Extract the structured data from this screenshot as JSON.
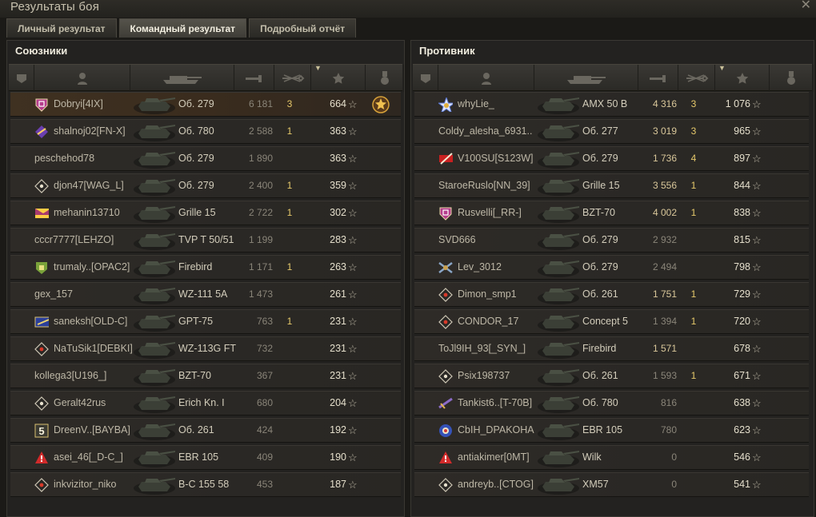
{
  "window": {
    "title": "Результаты боя",
    "close": "✕"
  },
  "tabs": [
    "Личный результат",
    "Командный результат",
    "Подробный отчёт"
  ],
  "active_tab": 1,
  "left": {
    "title": "Союзники",
    "rows": [
      {
        "player": "Dobryi[4IX]",
        "tank": "Об. 279",
        "damage": "6 181",
        "kills": "3",
        "xp": "664",
        "self": true,
        "medal": true,
        "badge": "shield",
        "dmg_hi": false
      },
      {
        "player": "shalnoj02[FN-X]",
        "tank": "Об. 780",
        "damage": "2 588",
        "kills": "1",
        "xp": "363",
        "badge": "purple"
      },
      {
        "player": "peschehod78",
        "tank": "Об. 279",
        "damage": "1 890",
        "kills": "",
        "xp": "363",
        "badge": ""
      },
      {
        "player": "djon47[WAG_L]",
        "tank": "Об. 279",
        "damage": "2 400",
        "kills": "1",
        "xp": "359",
        "badge": "diamond"
      },
      {
        "player": "mehanin13710",
        "tank": "Grille 15",
        "damage": "2 722",
        "kills": "1",
        "xp": "302",
        "badge": "legion"
      },
      {
        "player": "cccr7777[LEHZO]",
        "tank": "TVP T 50/51",
        "damage": "1 199",
        "kills": "",
        "xp": "283",
        "badge": ""
      },
      {
        "player": "trumaly..[OPAC2]",
        "tank": "Firebird",
        "damage": "1 171",
        "kills": "1",
        "xp": "263",
        "badge": "green"
      },
      {
        "player": "gex_157",
        "tank": "WZ-111 5A",
        "damage": "1 473",
        "kills": "",
        "xp": "261",
        "badge": ""
      },
      {
        "player": "saneksh[OLD-C]",
        "tank": "GPT-75",
        "damage": "763",
        "kills": "1",
        "xp": "231",
        "badge": "blue"
      },
      {
        "player": "NaTuSik1[DEBKI]",
        "tank": "WZ-113G FT",
        "damage": "732",
        "kills": "",
        "xp": "231",
        "badge": "diamond-red"
      },
      {
        "player": "kollega3[U196_]",
        "tank": "BZT-70",
        "damage": "367",
        "kills": "",
        "xp": "231",
        "badge": ""
      },
      {
        "player": "Geralt42rus",
        "tank": "Erich Kn. I",
        "damage": "680",
        "kills": "",
        "xp": "204",
        "badge": "diamond"
      },
      {
        "player": "DreenV..[BAYBA]",
        "tank": "Об. 261",
        "damage": "424",
        "kills": "",
        "xp": "192",
        "badge": "five",
        "badge_text": "5"
      },
      {
        "player": "asei_46[_D-C_]",
        "tank": "EBR 105",
        "damage": "409",
        "kills": "",
        "xp": "190",
        "badge": "warn"
      },
      {
        "player": "inkvizitor_niko",
        "tank": "B-C 155 58",
        "damage": "453",
        "kills": "",
        "xp": "187",
        "badge": "diamond-red"
      }
    ]
  },
  "right": {
    "title": "Противник",
    "rows": [
      {
        "player": "whyLie_",
        "tank": "AMX 50 B",
        "damage": "4 316",
        "kills": "3",
        "xp": "1 076",
        "badge": "star",
        "dmg_hi": true
      },
      {
        "player": "Coldy_alesha_6931..",
        "tank": "Об. 277",
        "damage": "3 019",
        "kills": "3",
        "xp": "965",
        "badge": "",
        "dmg_hi": true
      },
      {
        "player": "V100SU[S123W]",
        "tank": "Об. 279",
        "damage": "1 736",
        "kills": "4",
        "xp": "897",
        "badge": "red-flag",
        "dmg_hi": true
      },
      {
        "player": "StaroeRuslo[NN_39]",
        "tank": "Grille 15",
        "damage": "3 556",
        "kills": "1",
        "xp": "844",
        "badge": "",
        "dmg_hi": true
      },
      {
        "player": "Rusvelli[_RR-]",
        "tank": "BZT-70",
        "damage": "4 002",
        "kills": "1",
        "xp": "838",
        "badge": "shield",
        "dmg_hi": true
      },
      {
        "player": "SVD666",
        "tank": "Об. 279",
        "damage": "2 932",
        "kills": "",
        "xp": "815",
        "badge": ""
      },
      {
        "player": "Lev_3012",
        "tank": "Об. 279",
        "damage": "2 494",
        "kills": "",
        "xp": "798",
        "badge": "cross"
      },
      {
        "player": "Dimon_smp1",
        "tank": "Об. 261",
        "damage": "1 751",
        "kills": "1",
        "xp": "729",
        "badge": "diamond-red",
        "dmg_hi": true
      },
      {
        "player": "CONDOR_17",
        "tank": "Concept 5",
        "damage": "1 394",
        "kills": "1",
        "xp": "720",
        "badge": "diamond-red"
      },
      {
        "player": "ToJl9IH_93[_SYN_]",
        "tank": "Firebird",
        "damage": "1 571",
        "kills": "",
        "xp": "678",
        "badge": "",
        "dmg_hi": true
      },
      {
        "player": "Psix198737",
        "tank": "Об. 261",
        "damage": "1 593",
        "kills": "1",
        "xp": "671",
        "badge": "diamond"
      },
      {
        "player": "Tankist6..[T-70B]",
        "tank": "Об. 780",
        "damage": "816",
        "kills": "",
        "xp": "638",
        "badge": "sword"
      },
      {
        "player": "CbIH_DPAKOHA",
        "tank": "EBR 105",
        "damage": "780",
        "kills": "",
        "xp": "623",
        "badge": "flower"
      },
      {
        "player": "antiakimer[0MT]",
        "tank": "Wilk",
        "damage": "0",
        "kills": "",
        "xp": "546",
        "badge": "warn"
      },
      {
        "player": "andreyb..[CTOG]",
        "tank": "XM57",
        "damage": "0",
        "kills": "",
        "xp": "541",
        "badge": "diamond"
      }
    ]
  },
  "star_symbol": "☆",
  "colors": {
    "accent": "#e5c86a",
    "self_row": "#3f3121",
    "text": "#c9c4b4",
    "damage_high": "#d9c79a"
  }
}
